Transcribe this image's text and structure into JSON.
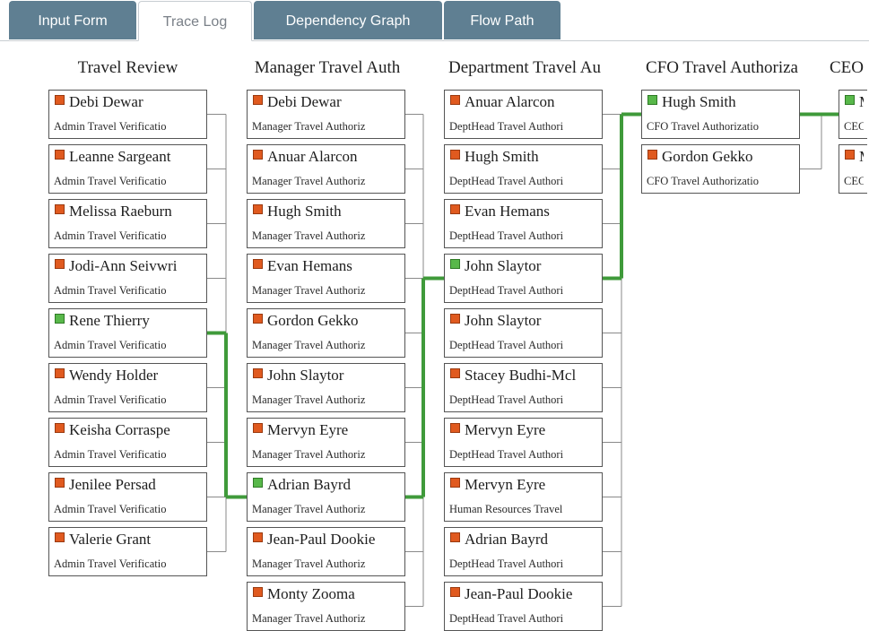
{
  "tabs": [
    {
      "label": "Input Form",
      "active": false
    },
    {
      "label": "Trace Log",
      "active": true
    },
    {
      "label": "Dependency Graph",
      "active": false
    },
    {
      "label": "Flow Path",
      "active": false
    }
  ],
  "colors": {
    "tab_bg": "#5f7f92",
    "status_pending": "#e05a1f",
    "status_done": "#58b84a",
    "path_line": "#3f9a3a"
  },
  "columns": [
    {
      "title": "Travel Review",
      "nodes": [
        {
          "name": "Debi Dewar",
          "role": "Admin Travel Verificatio",
          "status": "red"
        },
        {
          "name": "Leanne Sargeant",
          "role": "Admin Travel Verificatio",
          "status": "red"
        },
        {
          "name": "Melissa Raeburn",
          "role": "Admin Travel Verificatio",
          "status": "red"
        },
        {
          "name": "Jodi-Ann Seivwri",
          "role": "Admin Travel Verificatio",
          "status": "red"
        },
        {
          "name": "Rene Thierry",
          "role": "Admin Travel Verificatio",
          "status": "green"
        },
        {
          "name": "Wendy Holder",
          "role": "Admin Travel Verificatio",
          "status": "red"
        },
        {
          "name": "Keisha Corraspe",
          "role": "Admin Travel Verificatio",
          "status": "red"
        },
        {
          "name": "Jenilee Persad",
          "role": "Admin Travel Verificatio",
          "status": "red"
        },
        {
          "name": "Valerie Grant",
          "role": "Admin Travel Verificatio",
          "status": "red"
        }
      ]
    },
    {
      "title": "Manager Travel Auth",
      "nodes": [
        {
          "name": "Debi Dewar",
          "role": "Manager Travel Authoriz",
          "status": "red"
        },
        {
          "name": "Anuar Alarcon",
          "role": "Manager Travel Authoriz",
          "status": "red"
        },
        {
          "name": "Hugh Smith",
          "role": "Manager Travel Authoriz",
          "status": "red"
        },
        {
          "name": "Evan Hemans",
          "role": "Manager Travel Authoriz",
          "status": "red"
        },
        {
          "name": "Gordon Gekko",
          "role": "Manager Travel Authoriz",
          "status": "red"
        },
        {
          "name": "John Slaytor",
          "role": "Manager Travel Authoriz",
          "status": "red"
        },
        {
          "name": "Mervyn Eyre",
          "role": "Manager Travel Authoriz",
          "status": "red"
        },
        {
          "name": "Adrian Bayrd",
          "role": "Manager Travel Authoriz",
          "status": "green"
        },
        {
          "name": "Jean-Paul Dookie",
          "role": "Manager Travel Authoriz",
          "status": "red"
        },
        {
          "name": "Monty Zooma",
          "role": "Manager Travel Authoriz",
          "status": "red"
        }
      ]
    },
    {
      "title": "Department Travel Au",
      "nodes": [
        {
          "name": "Anuar Alarcon",
          "role": "DeptHead Travel Authori",
          "status": "red"
        },
        {
          "name": "Hugh Smith",
          "role": "DeptHead Travel Authori",
          "status": "red"
        },
        {
          "name": "Evan Hemans",
          "role": "DeptHead Travel Authori",
          "status": "red"
        },
        {
          "name": "John Slaytor",
          "role": "DeptHead Travel Authori",
          "status": "green"
        },
        {
          "name": "John Slaytor",
          "role": "DeptHead Travel Authori",
          "status": "red"
        },
        {
          "name": "Stacey Budhi-Mcl",
          "role": "DeptHead Travel Authori",
          "status": "red"
        },
        {
          "name": "Mervyn Eyre",
          "role": "DeptHead Travel Authori",
          "status": "red"
        },
        {
          "name": "Mervyn Eyre",
          "role": "Human Resources Travel",
          "status": "red"
        },
        {
          "name": "Adrian Bayrd",
          "role": "DeptHead Travel Authori",
          "status": "red"
        },
        {
          "name": "Jean-Paul Dookie",
          "role": "DeptHead Travel Authori",
          "status": "red"
        }
      ]
    },
    {
      "title": "CFO Travel Authoriza",
      "nodes": [
        {
          "name": "Hugh Smith",
          "role": "CFO Travel Authorizatio",
          "status": "green"
        },
        {
          "name": "Gordon Gekko",
          "role": "CFO Travel Authorizatio",
          "status": "red"
        }
      ]
    },
    {
      "title": "CEO",
      "nodes": [
        {
          "name": "M",
          "role": "CEC",
          "status": "green"
        },
        {
          "name": "M",
          "role": "CEC",
          "status": "red"
        }
      ]
    }
  ]
}
